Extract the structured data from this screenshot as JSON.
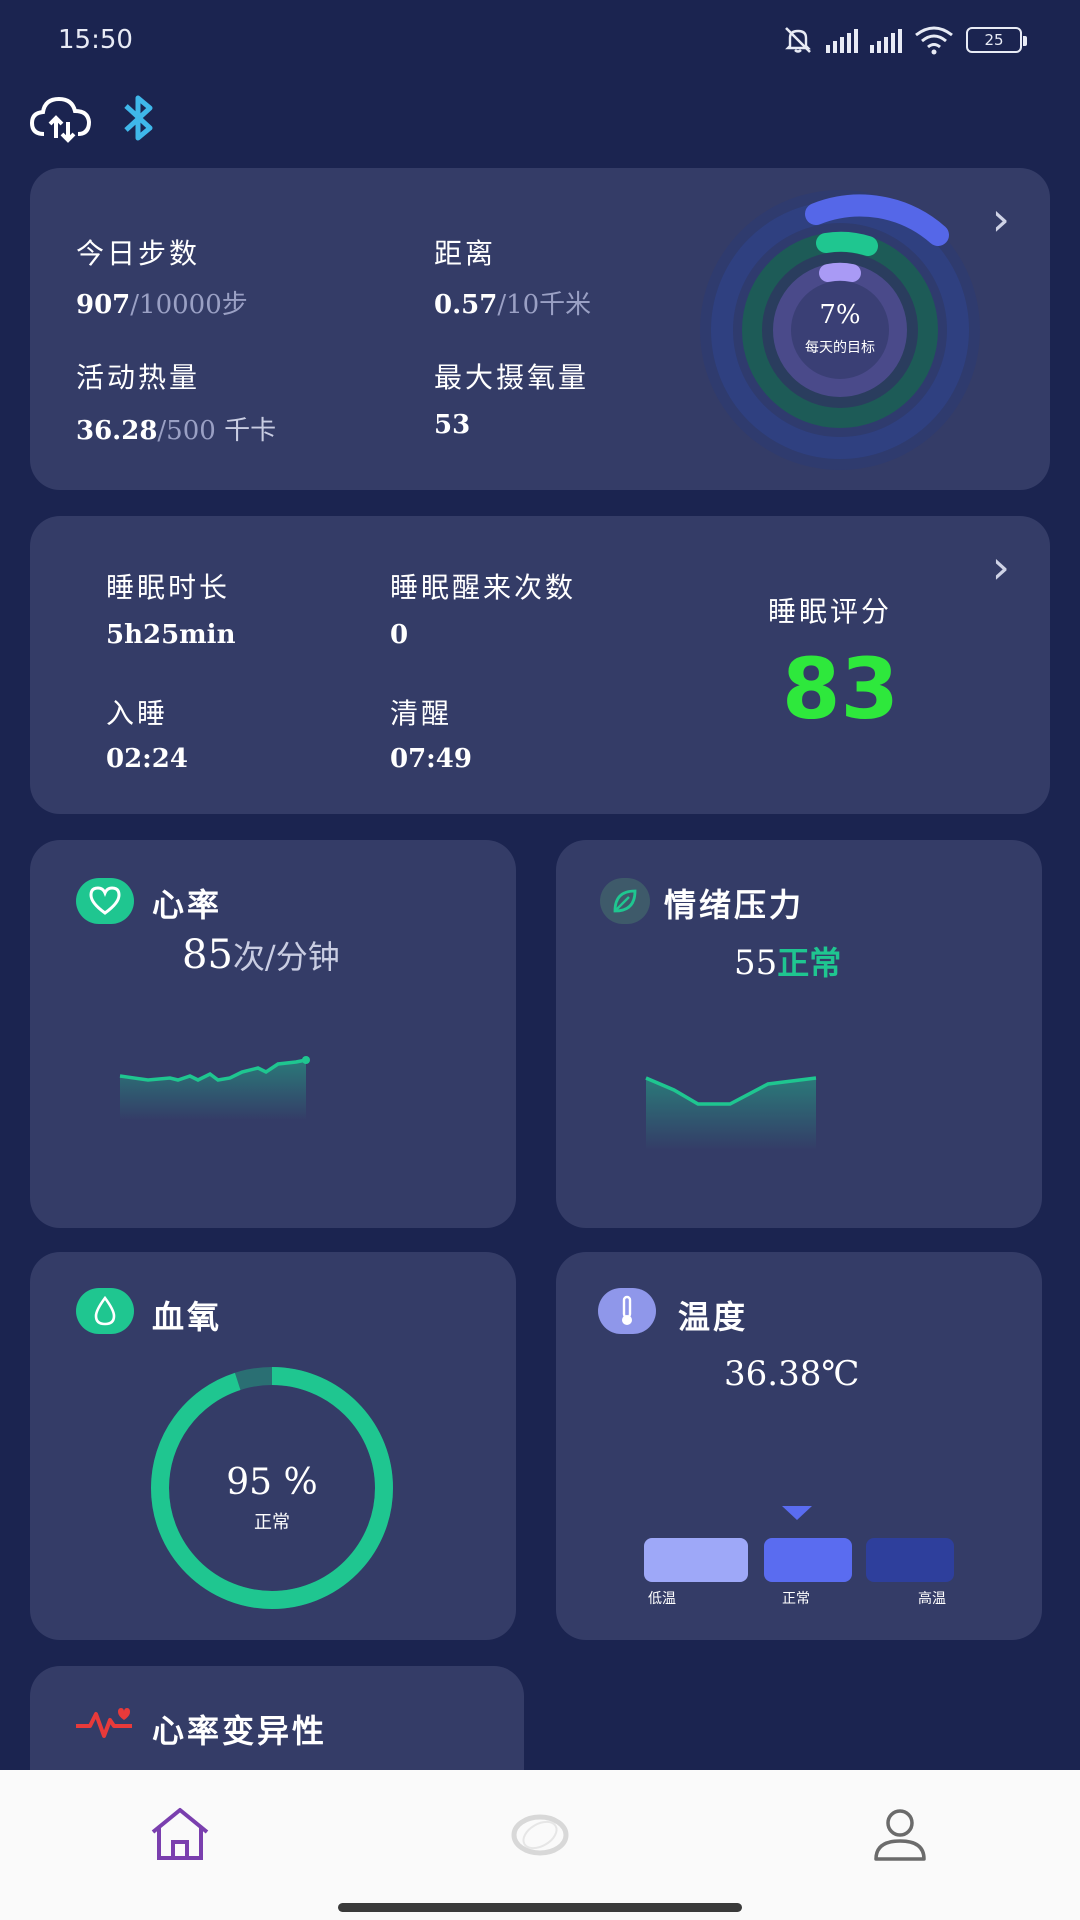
{
  "status": {
    "time": "15:50",
    "battery": "25",
    "network": "5G"
  },
  "steps_card": {
    "steps_label": "今日步数",
    "steps_value": "907",
    "steps_goal": "/10000步",
    "distance_label": "距离",
    "distance_value": "0.57",
    "distance_goal": "/10千米",
    "calories_label": "活动热量",
    "calories_value": "36.28",
    "calories_goal": "/500",
    "calories_unit": " 千卡",
    "vo2_label": "最大摄氧量",
    "vo2_value": "53",
    "ring_percent": "7%",
    "ring_caption": "每天的目标",
    "ring_progress": 0.07
  },
  "sleep_card": {
    "duration_label": "睡眠时长",
    "duration_value": "5h25min",
    "wake_count_label": "睡眠醒来次数",
    "wake_count_value": "0",
    "sleep_label": "入睡",
    "sleep_value": "02:24",
    "wake_label": "清醒",
    "wake_value": "07:49",
    "score_label": "睡眠评分",
    "score_value": "83"
  },
  "heart_card": {
    "title": "心率",
    "value": "85",
    "unit": "次/分钟"
  },
  "stress_card": {
    "title": "情绪压力",
    "value": "55",
    "status": "正常"
  },
  "spo2_card": {
    "title": "血氧",
    "value": "95 %",
    "status": "正常",
    "level": 0.95
  },
  "temp_card": {
    "title": "温度",
    "value": "36.38℃",
    "scale": [
      "低温",
      "正常",
      "高温"
    ],
    "selected": "正常"
  },
  "hrv_card": {
    "title": "心率变异性"
  },
  "colors": {
    "background": "#1b2450",
    "card": "#343c67",
    "accent_green": "#1fc690",
    "score_green": "#2ee83c",
    "ring_blue": "#5567e8",
    "ring_purple": "#a99af5",
    "nav_active": "#7a3fae"
  },
  "icons": {
    "cloud": "cloud-sync-icon",
    "bluetooth": "bluetooth-icon",
    "heart": "heart-icon",
    "leaf": "leaf-icon",
    "drop": "blood-drop-icon",
    "thermometer": "thermometer-icon",
    "pulse": "pulse-icon",
    "nav_home": "home-icon",
    "nav_device": "ring-device-icon",
    "nav_profile": "profile-icon"
  }
}
